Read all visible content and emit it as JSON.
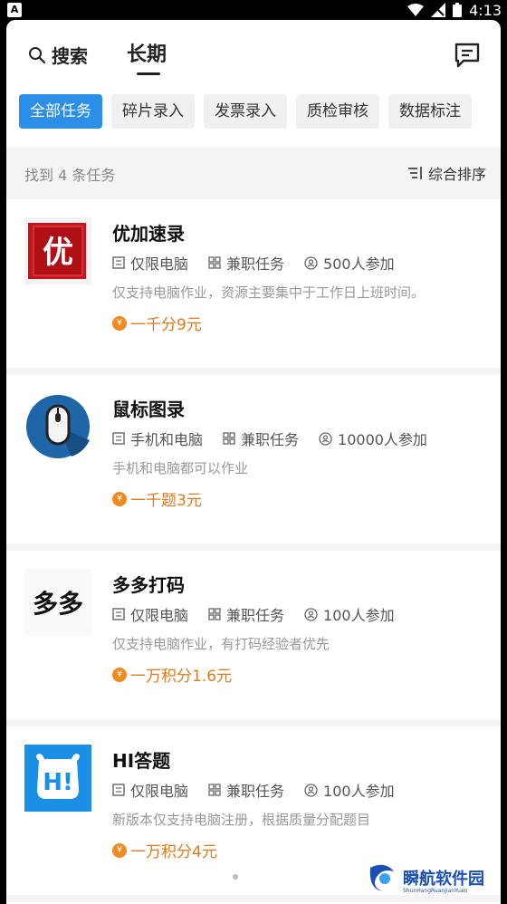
{
  "status_bar": {
    "time": "4:13"
  },
  "header": {
    "search_label": "搜索",
    "title": "长期"
  },
  "chips": [
    "全部任务",
    "碎片录入",
    "发票录入",
    "质检审核",
    "数据标注"
  ],
  "filter": {
    "found_text": "找到 4 条任务",
    "sort_label": "综合排序"
  },
  "tasks": [
    {
      "name": "优加速录",
      "device": "仅限电脑",
      "type": "兼职任务",
      "participants": "500人参加",
      "desc": "仅支持电脑作业，资源主要集中于工作日上班时间。",
      "reward": "一千分9元",
      "logo_text": "优"
    },
    {
      "name": "鼠标图录",
      "device": "手机和电脑",
      "type": "兼职任务",
      "participants": "10000人参加",
      "desc": "手机和电脑都可以作业",
      "reward": "一千题3元"
    },
    {
      "name": "多多打码",
      "device": "仅限电脑",
      "type": "兼职任务",
      "participants": "100人参加",
      "desc": "仅支持电脑作业，有打码经验者优先",
      "reward": "一万积分1.6元",
      "logo_text": "多多"
    },
    {
      "name": "HI答题",
      "device": "仅限电脑",
      "type": "兼职任务",
      "participants": "100人参加",
      "desc": "新版本仅支持电脑注册，根据质量分配题目",
      "reward": "一万积分4元",
      "logo_text": "H!"
    }
  ],
  "watermark": {
    "text": "瞬航软件园",
    "sub": "ShunHangRuanJianYuan"
  }
}
